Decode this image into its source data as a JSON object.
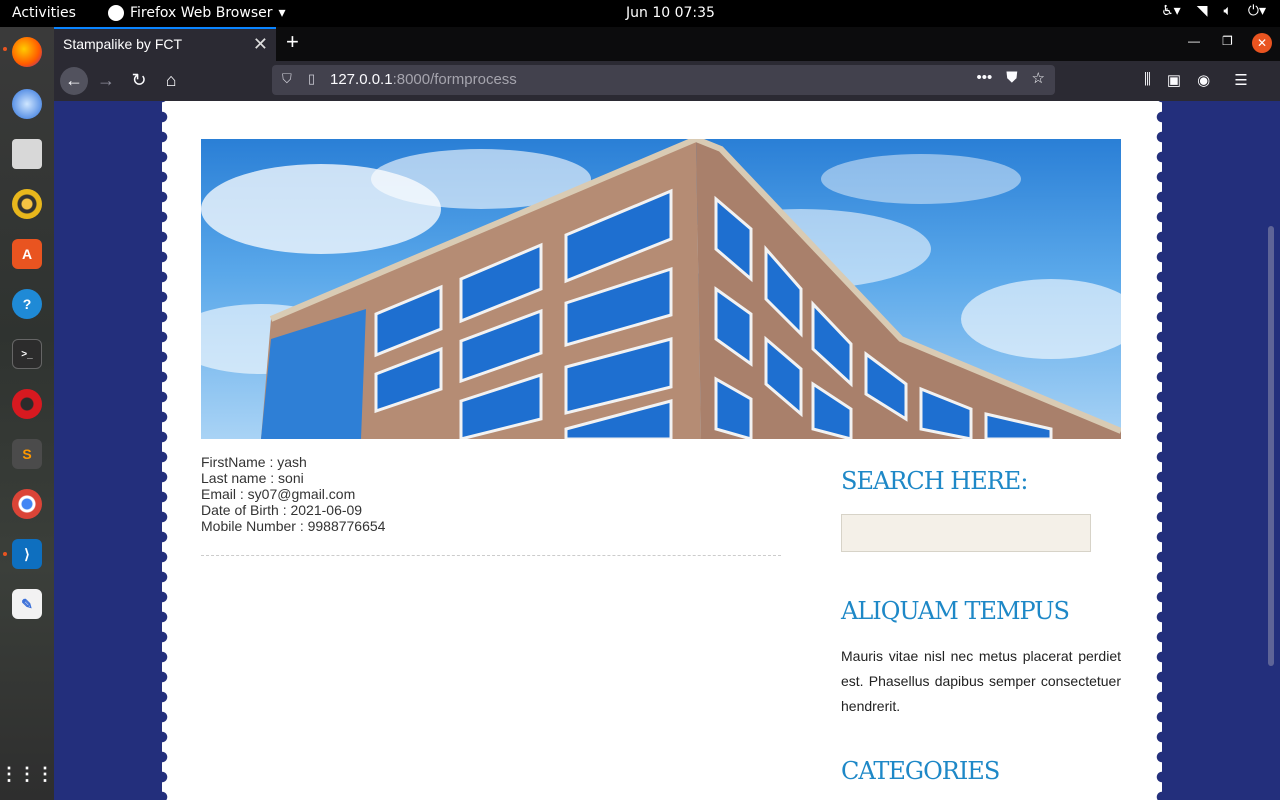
{
  "system_bar": {
    "activities": "Activities",
    "app_name": "Firefox Web Browser",
    "clock": "Jun 10  07:35"
  },
  "browser": {
    "tab_title": "Stampalike by FCT",
    "url_host": "127.0.0.1",
    "url_path": ":8000/formprocess"
  },
  "form_result": {
    "first_name": "FirstName : yash",
    "last_name": "Last name : soni",
    "email": "Email : sy07@gmail.com",
    "dob": "Date of Birth : 2021-06-09",
    "mobile": "Mobile Number : 9988776654"
  },
  "sidebar": {
    "search_heading": "SEARCH HERE:",
    "search_value": "",
    "aliquam_heading": "ALIQUAM TEMPUS",
    "aliquam_text": "Mauris vitae nisl nec metus placerat perdiet est. Phasellus dapibus semper consectetuer hendrerit.",
    "categories_heading": "CATEGORIES"
  },
  "icons": {
    "dock": [
      "firefox-icon",
      "thunderbird-icon",
      "files-icon",
      "rhythmbox-icon",
      "software-icon",
      "help-icon",
      "terminal-icon",
      "opera-icon",
      "sublime-icon",
      "chrome-icon",
      "vscode-icon",
      "text-editor-icon",
      "app-grid-icon"
    ]
  },
  "colors": {
    "page_background": "#232f7c",
    "heading_accent": "#1e88c7",
    "search_box": "#f4f0e8",
    "ubuntu_orange": "#e95420"
  }
}
